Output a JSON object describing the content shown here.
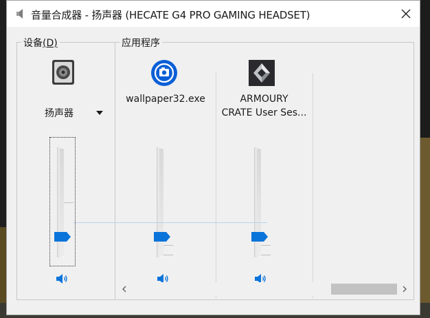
{
  "window": {
    "title": "音量合成器 - 扬声器 (HECATE G4 PRO GAMING HEADSET)",
    "close_icon": "close-icon"
  },
  "groups": {
    "device_label": "设备",
    "device_accel": "(D)",
    "apps_label": "应用程序"
  },
  "device": {
    "name": "扬声器",
    "icon": "speaker-device-icon",
    "volume_percent": 16,
    "muted": false
  },
  "apps": [
    {
      "name": "wallpaper32.exe",
      "icon": "wallpaper-engine-icon",
      "volume_percent": 16,
      "muted": false
    },
    {
      "name_line1": "ARMOURY",
      "name_line2": "CRATE User Ses...",
      "icon": "armoury-crate-icon",
      "volume_percent": 16,
      "muted": false
    }
  ],
  "colors": {
    "accent": "#0a74da",
    "window_bg": "#f0f0f0",
    "titlebar_bg": "#ffffff"
  },
  "scrollbar": {
    "left_icon": "chevron-left-icon",
    "right_icon": "chevron-right-icon"
  }
}
